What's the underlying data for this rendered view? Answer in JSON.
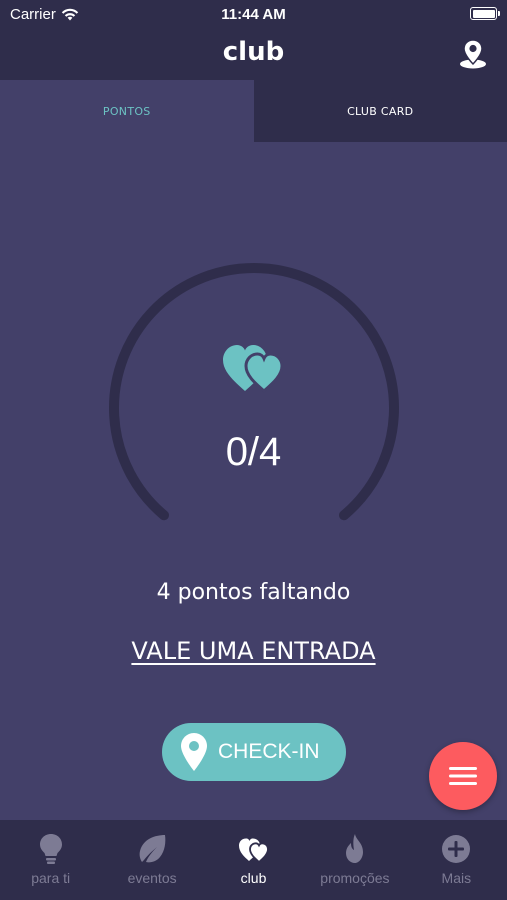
{
  "status_bar": {
    "carrier": "Carrier",
    "time": "11:44 AM"
  },
  "header": {
    "title": "club"
  },
  "tabs": [
    {
      "label": "PONTOS",
      "active": true
    },
    {
      "label": "CLUB CARD",
      "active": false
    }
  ],
  "points": {
    "current": 0,
    "total": 4,
    "display": "0/4",
    "missing_text": "4 pontos faltando",
    "reward_text": "VALE UMA ENTRADA"
  },
  "checkin": {
    "label": "CHECK-IN"
  },
  "bottom_nav": [
    {
      "label": "para ti",
      "icon": "lightbulb-icon",
      "active": false
    },
    {
      "label": "eventos",
      "icon": "leaf-icon",
      "active": false
    },
    {
      "label": "club",
      "icon": "hearts-icon",
      "active": true
    },
    {
      "label": "promoções",
      "icon": "flame-icon",
      "active": false
    },
    {
      "label": "Mais",
      "icon": "plus-circle-icon",
      "active": false
    }
  ],
  "colors": {
    "background": "#434069",
    "bar": "#2f2d4b",
    "accent": "#6cc2c3",
    "fab": "#fd5b5f",
    "gauge_track": "#2f2d4b"
  }
}
